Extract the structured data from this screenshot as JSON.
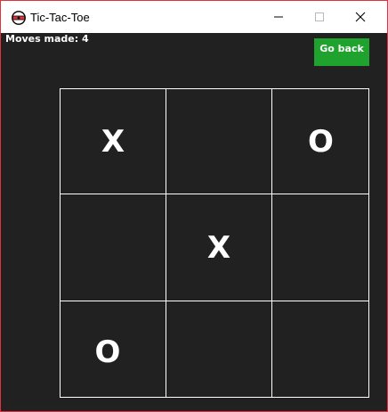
{
  "window": {
    "title": "Tic-Tac-Toe",
    "border_color": "#e0333d",
    "background": "#212121"
  },
  "status": {
    "moves_text": "Moves made: 4"
  },
  "toolbar": {
    "go_back_label": "Go back",
    "go_back_color": "#1fa22e"
  },
  "board": {
    "cells": [
      {
        "value": "X"
      },
      {
        "value": ""
      },
      {
        "value": "O"
      },
      {
        "value": ""
      },
      {
        "value": "X"
      },
      {
        "value": ""
      },
      {
        "value": "O"
      },
      {
        "value": ""
      },
      {
        "value": ""
      }
    ]
  }
}
